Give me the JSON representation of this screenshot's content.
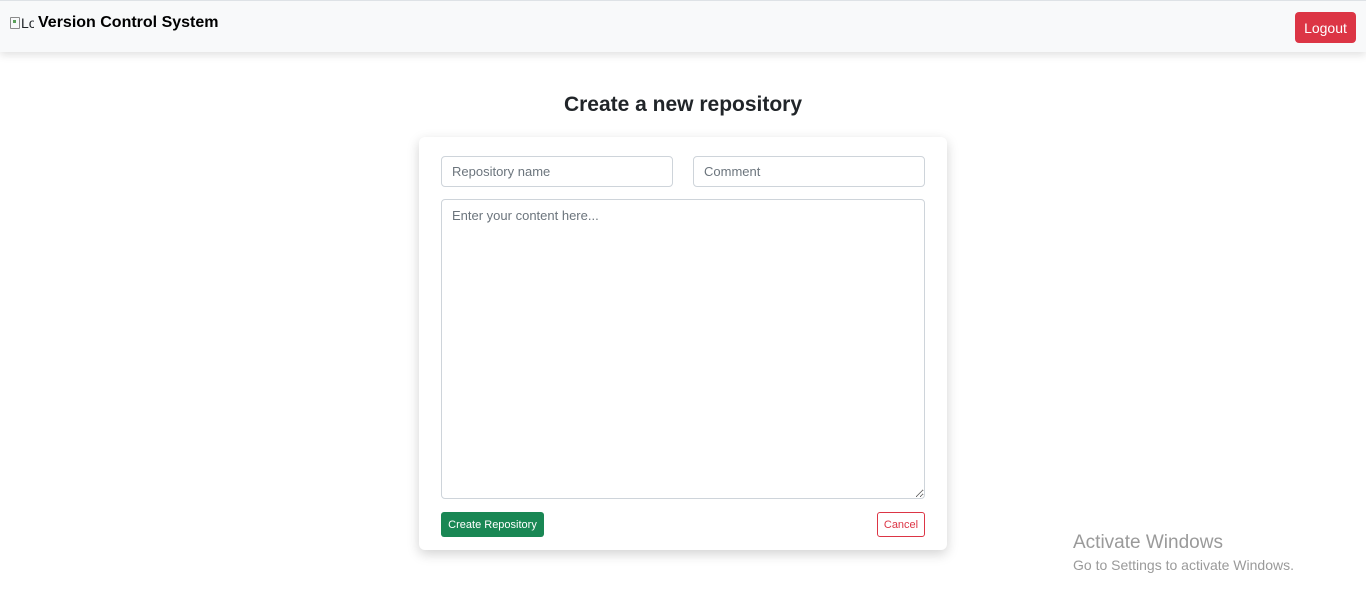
{
  "navbar": {
    "logo_alt": "Lo",
    "brand": "Version Control System",
    "logout_label": "Logout"
  },
  "page": {
    "title": "Create a new repository"
  },
  "form": {
    "repo_name_placeholder": "Repository name",
    "comment_placeholder": "Comment",
    "content_placeholder": "Enter your content here...",
    "create_label": "Create Repository",
    "cancel_label": "Cancel"
  },
  "watermark": {
    "title": "Activate Windows",
    "subtitle": "Go to Settings to activate Windows."
  },
  "colors": {
    "danger": "#dc3545",
    "success": "#198754",
    "navbar_bg": "#f8f9fa"
  },
  "icons": {
    "logo": "broken-image-icon"
  }
}
